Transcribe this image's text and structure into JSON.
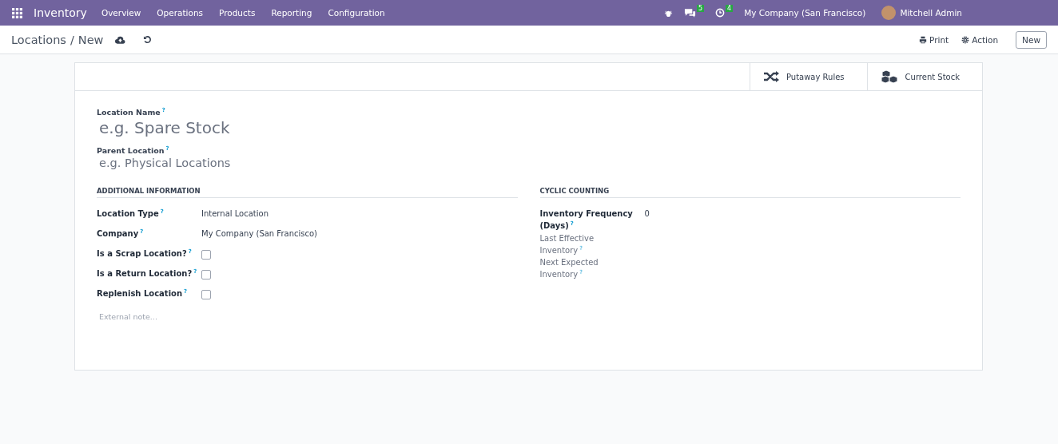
{
  "navbar": {
    "app_name": "Inventory",
    "menu": [
      "Overview",
      "Operations",
      "Products",
      "Reporting",
      "Configuration"
    ],
    "messages_count": "5",
    "activities_count": "4",
    "company": "My Company (San Francisco)",
    "user": "Mitchell Admin"
  },
  "breadcrumb": {
    "parent": "Locations",
    "separator": "/",
    "current": "New"
  },
  "actions": {
    "print": "Print",
    "action": "Action",
    "new": "New"
  },
  "smart_buttons": [
    {
      "kind": "shuffle",
      "label": "Putaway Rules"
    },
    {
      "kind": "cubes",
      "label": "Current Stock"
    }
  ],
  "title_fields": [
    {
      "label": "Location Name",
      "help": "?",
      "placeholder": "e.g. Spare Stock"
    },
    {
      "label": "Parent Location",
      "help": "?",
      "placeholder": "e.g. Physical Locations"
    }
  ],
  "sections": [
    {
      "title": "ADDITIONAL INFORMATION",
      "fields": [
        {
          "kind": "text",
          "label": "Location Type",
          "help": "?",
          "value": "Internal Location",
          "disabled": false
        },
        {
          "kind": "text",
          "label": "Company",
          "help": "?",
          "value": "My Company (San Francisco)",
          "disabled": false
        },
        {
          "kind": "checkbox",
          "label": "Is a Scrap Location?",
          "help": "?",
          "checked": false,
          "disabled": false
        },
        {
          "kind": "checkbox",
          "label": "Is a Return Location?",
          "help": "?",
          "checked": false,
          "disabled": false
        },
        {
          "kind": "checkbox",
          "label": "Replenish Location",
          "help": "?",
          "checked": false,
          "disabled": false
        }
      ]
    },
    {
      "title": "CYCLIC COUNTING",
      "fields": [
        {
          "kind": "text",
          "label": "Inventory Frequency (Days)",
          "help": "?",
          "value": "0",
          "disabled": false
        },
        {
          "kind": "text",
          "label": "Last Effective Inventory",
          "help": "?",
          "disabled": true
        },
        {
          "kind": "text",
          "label": "Next Expected Inventory",
          "help": "?",
          "disabled": true
        }
      ]
    }
  ],
  "note": {
    "placeholder": "External note..."
  }
}
